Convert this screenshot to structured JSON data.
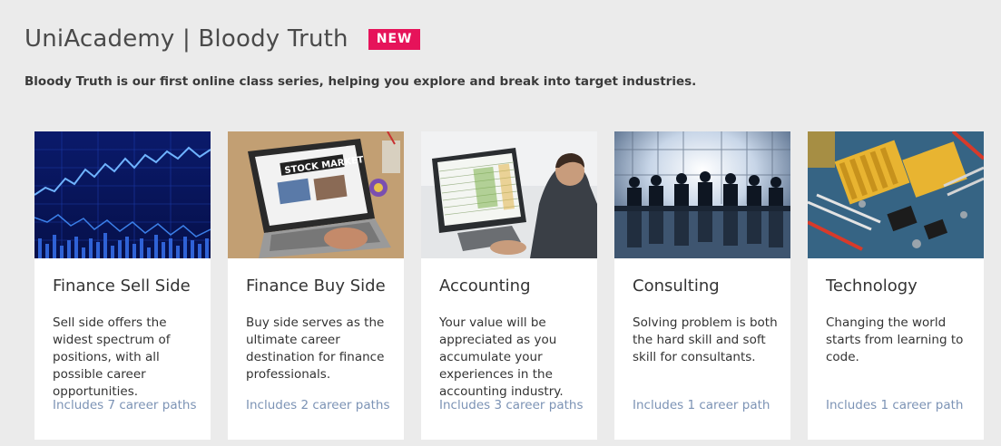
{
  "header": {
    "title": "UniAcademy | Bloody Truth",
    "badge": "NEW",
    "subtitle": "Bloody Truth is our first online class series, helping you explore and break into target industries."
  },
  "colors": {
    "background": "#ebebeb",
    "badge": "#e6135a",
    "link": "#7c93b5"
  },
  "cards": [
    {
      "image_name": "stock-chart-image",
      "title": "Finance Sell Side",
      "description": "Sell side offers the widest spectrum of positions, with all possible career opportunities.",
      "link": "Includes 7 career paths"
    },
    {
      "image_name": "laptop-stock-market-image",
      "title": "Finance Buy Side",
      "description": "Buy side serves as the ultimate career destination for finance professionals.",
      "link": "Includes 2 career paths"
    },
    {
      "image_name": "spreadsheet-analyst-image",
      "title": "Accounting",
      "description": "Your value will be appreciated as you accumulate your experiences in the accounting industry.",
      "link": "Includes 3 career paths"
    },
    {
      "image_name": "boardroom-meeting-image",
      "title": "Consulting",
      "description": "Solving problem is both the hard skill and soft skill for consultants.",
      "link": "Includes 1 career path"
    },
    {
      "image_name": "circuit-board-image",
      "title": "Technology",
      "description": "Changing the world starts from learning to code.",
      "link": "Includes 1 career path"
    }
  ]
}
